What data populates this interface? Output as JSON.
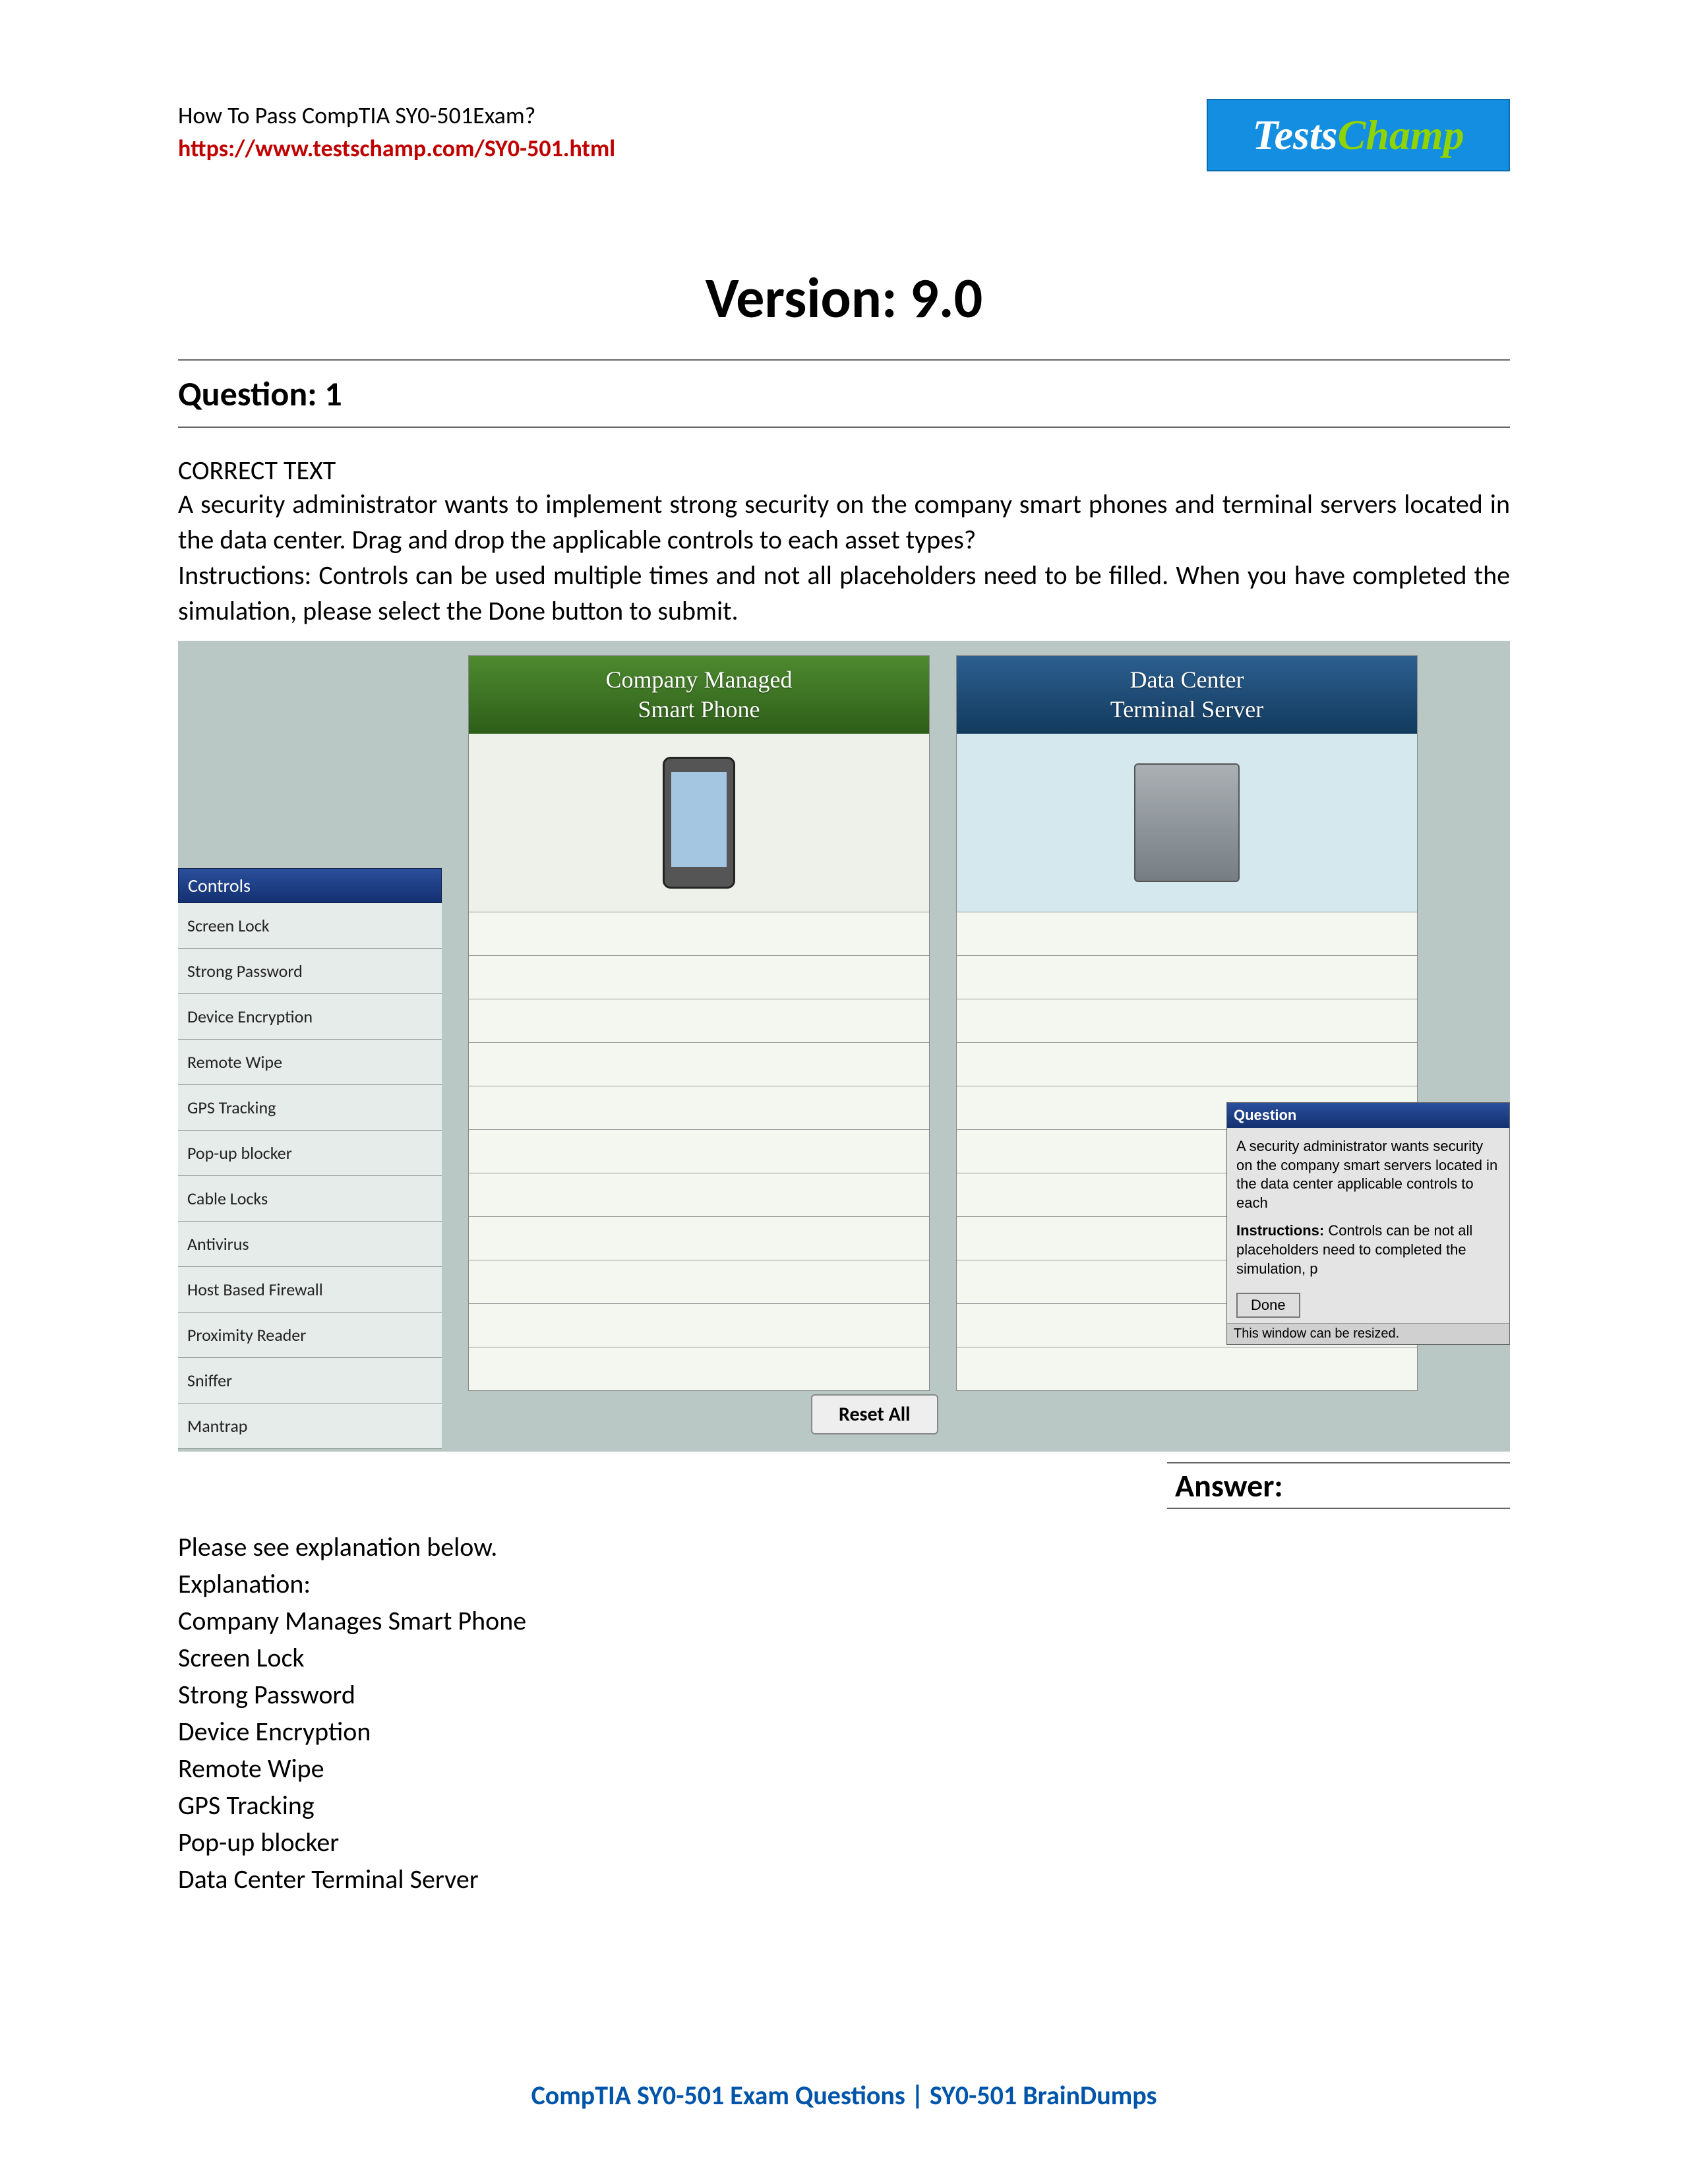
{
  "header": {
    "line1": "How To Pass CompTIA SY0-501Exam?",
    "link": "https://www.testschamp.com/SY0-501.html"
  },
  "logo": {
    "part1": "Tests",
    "part2": "Champ"
  },
  "version": "Version: 9.0",
  "question_heading": "Question: 1",
  "correct_text_label": "CORRECT TEXT",
  "question_body_1": "A security administrator wants to implement strong security on the company smart phones and terminal servers located in the data center. Drag and drop the applicable controls to each asset types?",
  "question_body_2": "Instructions: Controls can be used multiple times and not all placeholders need to be filled. When you have completed the simulation, please select the Done button to submit.",
  "sim": {
    "controls_header": "Controls",
    "controls": [
      "Screen Lock",
      "Strong Password",
      "Device Encryption",
      "Remote Wipe",
      "GPS Tracking",
      "Pop-up blocker",
      "Cable Locks",
      "Antivirus",
      "Host Based Firewall",
      "Proximity Reader",
      "Sniffer",
      "Mantrap"
    ],
    "col_left_l1": "Company Managed",
    "col_left_l2": "Smart Phone",
    "col_right_l1": "Data Center",
    "col_right_l2": "Terminal Server",
    "reset": "Reset All",
    "popup": {
      "title": "Question",
      "body1": "A security administrator wants security on the company smart servers located in the data center applicable controls to each",
      "body2_bold": "Instructions:",
      "body2_rest": " Controls can be not all placeholders need to completed the simulation, p",
      "done": "Done",
      "resize": "This window can be resized."
    }
  },
  "answer_label": "Answer:",
  "explanation": {
    "intro": "Please see explanation below.",
    "label": "Explanation:",
    "group1_title": "Company Manages Smart Phone",
    "group1": [
      "Screen Lock",
      "Strong Password",
      "Device Encryption",
      "Remote Wipe",
      "GPS Tracking",
      "Pop-up blocker"
    ],
    "group2_title": "Data Center Terminal Server"
  },
  "footer": "CompTIA SY0-501 Exam Questions | SY0-501 BrainDumps"
}
